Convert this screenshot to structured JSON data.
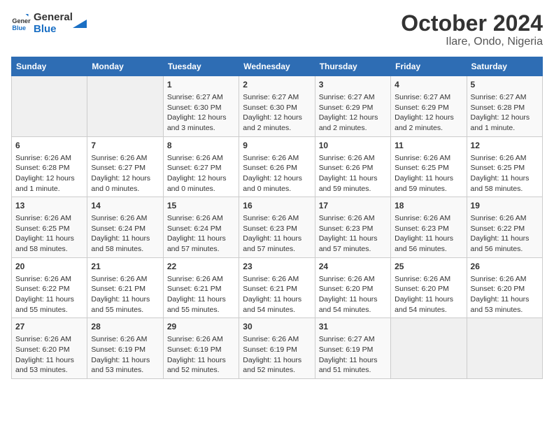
{
  "logo": {
    "text1": "General",
    "text2": "Blue"
  },
  "title": "October 2024",
  "subtitle": "Ilare, Ondo, Nigeria",
  "headers": [
    "Sunday",
    "Monday",
    "Tuesday",
    "Wednesday",
    "Thursday",
    "Friday",
    "Saturday"
  ],
  "weeks": [
    [
      {
        "day": "",
        "info": ""
      },
      {
        "day": "",
        "info": ""
      },
      {
        "day": "1",
        "info": "Sunrise: 6:27 AM\nSunset: 6:30 PM\nDaylight: 12 hours and 3 minutes."
      },
      {
        "day": "2",
        "info": "Sunrise: 6:27 AM\nSunset: 6:30 PM\nDaylight: 12 hours and 2 minutes."
      },
      {
        "day": "3",
        "info": "Sunrise: 6:27 AM\nSunset: 6:29 PM\nDaylight: 12 hours and 2 minutes."
      },
      {
        "day": "4",
        "info": "Sunrise: 6:27 AM\nSunset: 6:29 PM\nDaylight: 12 hours and 2 minutes."
      },
      {
        "day": "5",
        "info": "Sunrise: 6:27 AM\nSunset: 6:28 PM\nDaylight: 12 hours and 1 minute."
      }
    ],
    [
      {
        "day": "6",
        "info": "Sunrise: 6:26 AM\nSunset: 6:28 PM\nDaylight: 12 hours and 1 minute."
      },
      {
        "day": "7",
        "info": "Sunrise: 6:26 AM\nSunset: 6:27 PM\nDaylight: 12 hours and 0 minutes."
      },
      {
        "day": "8",
        "info": "Sunrise: 6:26 AM\nSunset: 6:27 PM\nDaylight: 12 hours and 0 minutes."
      },
      {
        "day": "9",
        "info": "Sunrise: 6:26 AM\nSunset: 6:26 PM\nDaylight: 12 hours and 0 minutes."
      },
      {
        "day": "10",
        "info": "Sunrise: 6:26 AM\nSunset: 6:26 PM\nDaylight: 11 hours and 59 minutes."
      },
      {
        "day": "11",
        "info": "Sunrise: 6:26 AM\nSunset: 6:25 PM\nDaylight: 11 hours and 59 minutes."
      },
      {
        "day": "12",
        "info": "Sunrise: 6:26 AM\nSunset: 6:25 PM\nDaylight: 11 hours and 58 minutes."
      }
    ],
    [
      {
        "day": "13",
        "info": "Sunrise: 6:26 AM\nSunset: 6:25 PM\nDaylight: 11 hours and 58 minutes."
      },
      {
        "day": "14",
        "info": "Sunrise: 6:26 AM\nSunset: 6:24 PM\nDaylight: 11 hours and 58 minutes."
      },
      {
        "day": "15",
        "info": "Sunrise: 6:26 AM\nSunset: 6:24 PM\nDaylight: 11 hours and 57 minutes."
      },
      {
        "day": "16",
        "info": "Sunrise: 6:26 AM\nSunset: 6:23 PM\nDaylight: 11 hours and 57 minutes."
      },
      {
        "day": "17",
        "info": "Sunrise: 6:26 AM\nSunset: 6:23 PM\nDaylight: 11 hours and 57 minutes."
      },
      {
        "day": "18",
        "info": "Sunrise: 6:26 AM\nSunset: 6:23 PM\nDaylight: 11 hours and 56 minutes."
      },
      {
        "day": "19",
        "info": "Sunrise: 6:26 AM\nSunset: 6:22 PM\nDaylight: 11 hours and 56 minutes."
      }
    ],
    [
      {
        "day": "20",
        "info": "Sunrise: 6:26 AM\nSunset: 6:22 PM\nDaylight: 11 hours and 55 minutes."
      },
      {
        "day": "21",
        "info": "Sunrise: 6:26 AM\nSunset: 6:21 PM\nDaylight: 11 hours and 55 minutes."
      },
      {
        "day": "22",
        "info": "Sunrise: 6:26 AM\nSunset: 6:21 PM\nDaylight: 11 hours and 55 minutes."
      },
      {
        "day": "23",
        "info": "Sunrise: 6:26 AM\nSunset: 6:21 PM\nDaylight: 11 hours and 54 minutes."
      },
      {
        "day": "24",
        "info": "Sunrise: 6:26 AM\nSunset: 6:20 PM\nDaylight: 11 hours and 54 minutes."
      },
      {
        "day": "25",
        "info": "Sunrise: 6:26 AM\nSunset: 6:20 PM\nDaylight: 11 hours and 54 minutes."
      },
      {
        "day": "26",
        "info": "Sunrise: 6:26 AM\nSunset: 6:20 PM\nDaylight: 11 hours and 53 minutes."
      }
    ],
    [
      {
        "day": "27",
        "info": "Sunrise: 6:26 AM\nSunset: 6:20 PM\nDaylight: 11 hours and 53 minutes."
      },
      {
        "day": "28",
        "info": "Sunrise: 6:26 AM\nSunset: 6:19 PM\nDaylight: 11 hours and 53 minutes."
      },
      {
        "day": "29",
        "info": "Sunrise: 6:26 AM\nSunset: 6:19 PM\nDaylight: 11 hours and 52 minutes."
      },
      {
        "day": "30",
        "info": "Sunrise: 6:26 AM\nSunset: 6:19 PM\nDaylight: 11 hours and 52 minutes."
      },
      {
        "day": "31",
        "info": "Sunrise: 6:27 AM\nSunset: 6:19 PM\nDaylight: 11 hours and 51 minutes."
      },
      {
        "day": "",
        "info": ""
      },
      {
        "day": "",
        "info": ""
      }
    ]
  ]
}
